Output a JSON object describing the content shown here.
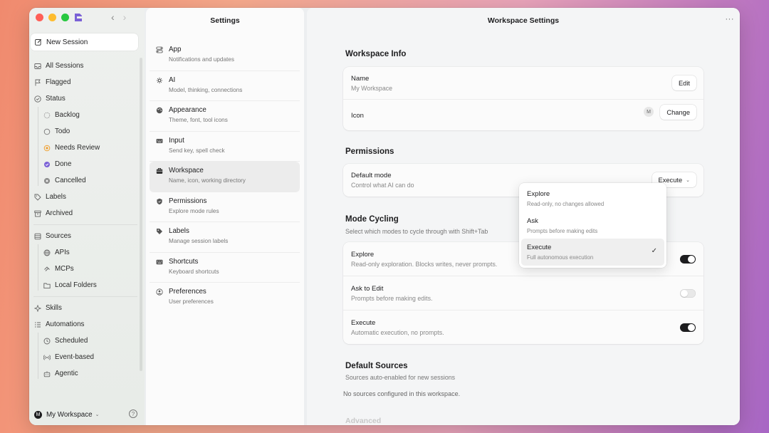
{
  "sidebar": {
    "new_session_label": "New Session",
    "nav": [
      {
        "label": "All Sessions",
        "icon": "inbox-icon"
      },
      {
        "label": "Flagged",
        "icon": "flag-icon"
      },
      {
        "label": "Status",
        "icon": "status-icon"
      }
    ],
    "status_items": [
      "Backlog",
      "Todo",
      "Needs Review",
      "Done",
      "Cancelled"
    ],
    "labels_label": "Labels",
    "archived_label": "Archived",
    "sources_label": "Sources",
    "source_items": [
      "APIs",
      "MCPs",
      "Local Folders"
    ],
    "skills_label": "Skills",
    "automations_label": "Automations",
    "automation_items": [
      "Scheduled",
      "Event-based",
      "Agentic"
    ],
    "workspace_initial": "M",
    "workspace_name": "My Workspace",
    "help_symbol": "?"
  },
  "settings": {
    "title": "Settings",
    "items": [
      {
        "title": "App",
        "desc": "Notifications and updates"
      },
      {
        "title": "AI",
        "desc": "Model, thinking, connections"
      },
      {
        "title": "Appearance",
        "desc": "Theme, font, tool icons"
      },
      {
        "title": "Input",
        "desc": "Send key, spell check"
      },
      {
        "title": "Workspace",
        "desc": "Name, icon, working directory"
      },
      {
        "title": "Permissions",
        "desc": "Explore mode rules"
      },
      {
        "title": "Labels",
        "desc": "Manage session labels"
      },
      {
        "title": "Shortcuts",
        "desc": "Keyboard shortcuts"
      },
      {
        "title": "Preferences",
        "desc": "User preferences"
      }
    ]
  },
  "main": {
    "title": "Workspace Settings",
    "more_symbol": "···",
    "workspace_info": {
      "title": "Workspace Info",
      "name_label": "Name",
      "name_value": "My Workspace",
      "edit_label": "Edit",
      "icon_label": "Icon",
      "icon_initial": "M",
      "change_label": "Change"
    },
    "permissions": {
      "title": "Permissions",
      "default_mode_label": "Default mode",
      "default_mode_desc": "Control what AI can do",
      "selected_mode": "Execute"
    },
    "mode_cycling": {
      "title": "Mode Cycling",
      "subtitle": "Select which modes to cycle through with Shift+Tab",
      "modes": [
        {
          "label": "Explore",
          "desc": "Read-only exploration. Blocks writes, never prompts.",
          "enabled": true
        },
        {
          "label": "Ask to Edit",
          "desc": "Prompts before making edits.",
          "enabled": false
        },
        {
          "label": "Execute",
          "desc": "Automatic execution, no prompts.",
          "enabled": true
        }
      ]
    },
    "default_sources": {
      "title": "Default Sources",
      "subtitle": "Sources auto-enabled for new sessions",
      "empty_note": "No sources configured in this workspace."
    },
    "advanced_title": "Advanced"
  },
  "dropdown": {
    "options": [
      {
        "title": "Explore",
        "desc": "Read-only, no changes allowed"
      },
      {
        "title": "Ask",
        "desc": "Prompts before making edits"
      },
      {
        "title": "Execute",
        "desc": "Full autonomous execution"
      }
    ],
    "selected_index": 2
  },
  "colors": {
    "status_needs_review": "#f0a030",
    "status_done": "#7b61d6",
    "toggle_on": "#1d1d1f"
  }
}
